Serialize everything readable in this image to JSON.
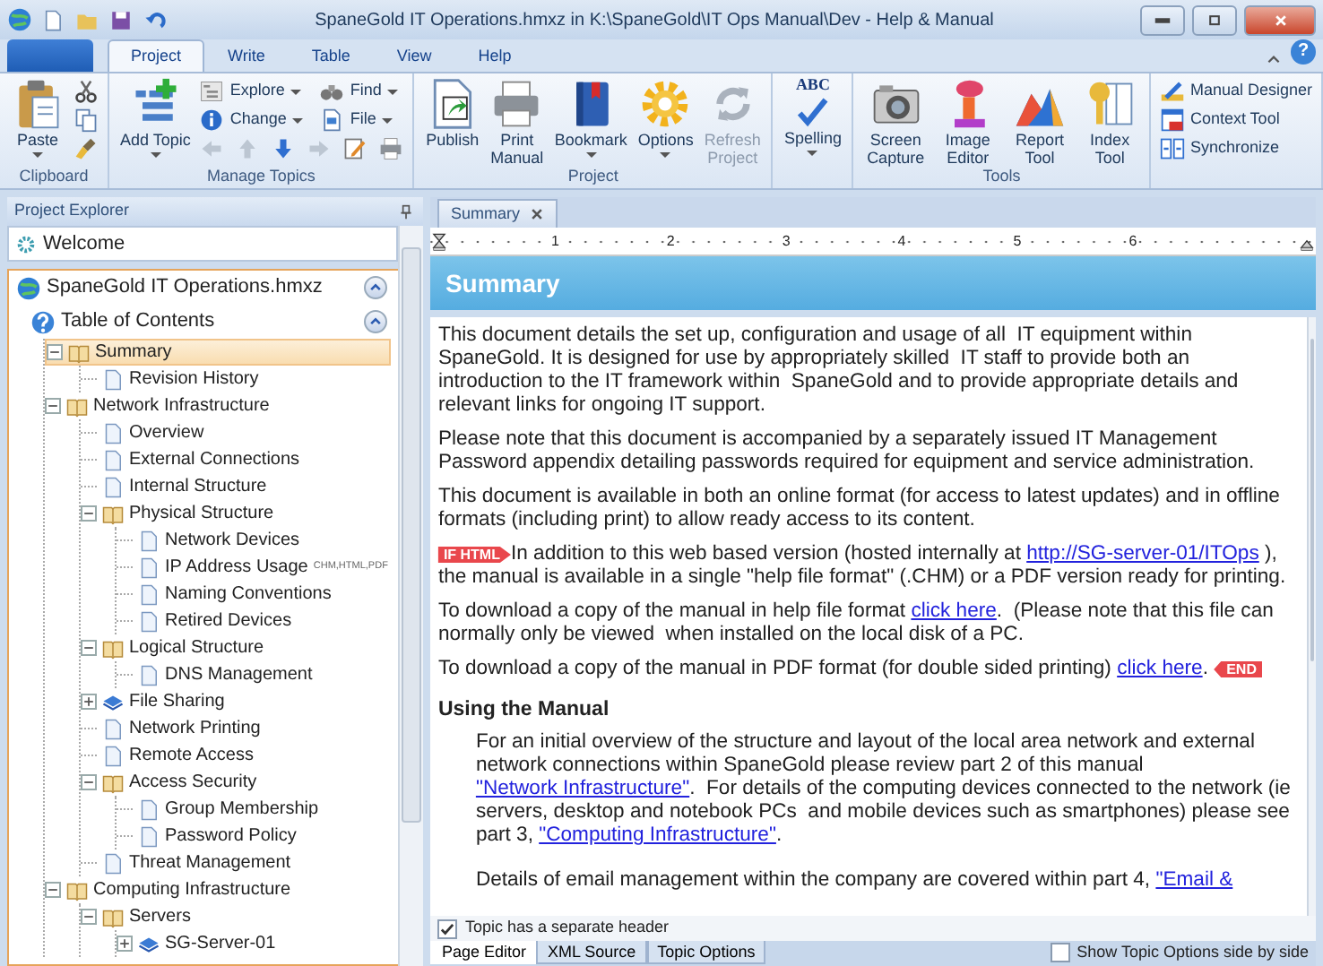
{
  "window": {
    "title": "SpaneGold IT Operations.hmxz in K:\\SpaneGold\\IT Ops Manual\\Dev - Help & Manual"
  },
  "ribbon_tabs": [
    {
      "label": "Project",
      "selected": true
    },
    {
      "label": "Write",
      "selected": false
    },
    {
      "label": "Table",
      "selected": false
    },
    {
      "label": "View",
      "selected": false
    },
    {
      "label": "Help",
      "selected": false
    }
  ],
  "help_button": "?",
  "ribbon_groups": [
    {
      "label": "Clipboard",
      "items": [
        {
          "label": "Paste",
          "kind": "large",
          "menu": true,
          "disabled": false
        }
      ]
    },
    {
      "label": "Manage Topics",
      "items": [
        {
          "label": "Add Topic",
          "kind": "wide",
          "menu": true,
          "disabled": false
        },
        {
          "label": "Explore",
          "kind": "small",
          "menu": true,
          "disabled": false
        },
        {
          "label": "Find",
          "kind": "small",
          "menu": true,
          "disabled": false
        },
        {
          "label": "Change",
          "kind": "small",
          "menu": true,
          "disabled": false
        },
        {
          "label": "File",
          "kind": "small",
          "menu": true,
          "disabled": false
        }
      ]
    },
    {
      "label": "Project",
      "items": [
        {
          "label": "Publish",
          "kind": "large",
          "menu": false,
          "disabled": false
        },
        {
          "label": "Print Manual",
          "kind": "large",
          "menu": false,
          "disabled": false
        },
        {
          "label": "Bookmark",
          "kind": "large",
          "menu": true,
          "disabled": false
        },
        {
          "label": "Options",
          "kind": "large",
          "menu": true,
          "disabled": false
        },
        {
          "label": "Refresh Project",
          "kind": "large",
          "menu": false,
          "disabled": true
        }
      ]
    },
    {
      "items": [
        {
          "label": "Spelling",
          "kind": "large",
          "menu": true,
          "disabled": false,
          "icon_text": "ABC"
        }
      ]
    },
    {
      "label": "Tools",
      "items": [
        {
          "label": "Screen Capture",
          "kind": "large",
          "menu": false,
          "disabled": false
        },
        {
          "label": "Image Editor",
          "kind": "large",
          "menu": false,
          "disabled": false
        },
        {
          "label": "Report Tool",
          "kind": "large",
          "menu": false,
          "disabled": false
        },
        {
          "label": "Index Tool",
          "kind": "large",
          "menu": false,
          "disabled": false
        }
      ]
    },
    {
      "items": [
        {
          "label": "Manual Designer",
          "kind": "list",
          "menu": false,
          "disabled": false
        },
        {
          "label": "Context Tool",
          "kind": "list",
          "menu": false,
          "disabled": false
        },
        {
          "label": "Synchronize",
          "kind": "list",
          "menu": false,
          "disabled": false
        }
      ]
    }
  ],
  "explorer": {
    "title": "Project Explorer",
    "welcome": "Welcome",
    "project": "SpaneGold IT Operations.hmxz",
    "toc": "Table of Contents",
    "tree": [
      {
        "label": "Summary",
        "kind": "book",
        "expanded": true,
        "selected": true,
        "children": [
          {
            "label": "Revision History",
            "kind": "page",
            "selected": false
          }
        ]
      },
      {
        "label": "Network Infrastructure",
        "kind": "book",
        "expanded": true,
        "selected": false,
        "children": [
          {
            "label": "Overview",
            "kind": "page",
            "selected": false
          },
          {
            "label": "External Connections",
            "kind": "page",
            "selected": false
          },
          {
            "label": "Internal Structure",
            "kind": "page",
            "selected": false
          },
          {
            "label": "Physical Structure",
            "kind": "book",
            "expanded": true,
            "selected": false,
            "children": [
              {
                "label": "Network Devices",
                "kind": "page",
                "selected": false
              },
              {
                "label": "IP Address Usage",
                "kind": "page",
                "selected": false,
                "tag": "CHM,HTML,PDF"
              },
              {
                "label": "Naming Conventions",
                "kind": "page",
                "selected": false
              },
              {
                "label": "Retired Devices",
                "kind": "page",
                "selected": false
              }
            ]
          },
          {
            "label": "Logical Structure",
            "kind": "book",
            "expanded": true,
            "selected": false,
            "children": [
              {
                "label": "DNS Management",
                "kind": "page",
                "selected": false
              }
            ]
          },
          {
            "label": "File Sharing",
            "kind": "folder",
            "expanded": false,
            "selected": false
          },
          {
            "label": "Network Printing",
            "kind": "page",
            "selected": false
          },
          {
            "label": "Remote Access",
            "kind": "page",
            "selected": false
          },
          {
            "label": "Access Security",
            "kind": "book",
            "expanded": true,
            "selected": false,
            "children": [
              {
                "label": "Group Membership",
                "kind": "page",
                "selected": false
              },
              {
                "label": "Password Policy",
                "kind": "page",
                "selected": false
              }
            ]
          },
          {
            "label": "Threat Management",
            "kind": "page",
            "selected": false
          }
        ]
      },
      {
        "label": "Computing Infrastructure",
        "kind": "book",
        "expanded": true,
        "selected": false,
        "children": [
          {
            "label": "Servers",
            "kind": "book",
            "expanded": true,
            "selected": false,
            "children": [
              {
                "label": "SG-Server-01",
                "kind": "folder",
                "expanded": false,
                "selected": false
              }
            ]
          }
        ]
      }
    ]
  },
  "editor": {
    "tab": "Summary",
    "ruler": [
      "1",
      "2",
      "3",
      "4",
      "5",
      "6"
    ],
    "header_title": "Summary",
    "blocks": [
      {
        "kind": "paragraph",
        "parts": [
          {
            "kind": "text",
            "text": "This document details the set up, configuration and usage of all  IT equipment within SpaneGold. It is designed for use by appropriately skilled  IT staff to provide both an introduction to the IT framework within  SpaneGold and to provide appropriate details and relevant links for ongoing IT support."
          }
        ]
      },
      {
        "kind": "paragraph",
        "parts": [
          {
            "kind": "text",
            "text": "Please note that this document is accompanied by a separately issued IT Management Password appendix detailing passwords required for equipment and service administration."
          }
        ]
      },
      {
        "kind": "paragraph",
        "parts": [
          {
            "kind": "text",
            "text": "This document is available in both an online format (for access to latest updates) and in offline formats (including print) to allow ready access to its content."
          }
        ]
      },
      {
        "kind": "paragraph",
        "parts": [
          {
            "kind": "condition_start",
            "text": "IF HTML"
          },
          {
            "kind": "text",
            "text": "In addition to this web based version (hosted internally at "
          },
          {
            "kind": "link",
            "text": "http://SG-server-01/ITOps"
          },
          {
            "kind": "text",
            "text": " ), the manual is available in a single \"help file format\" (.CHM) or a PDF version ready for printing."
          }
        ]
      },
      {
        "kind": "paragraph",
        "parts": [
          {
            "kind": "text",
            "text": "To download a copy of the manual in help file format "
          },
          {
            "kind": "link",
            "text": "click here"
          },
          {
            "kind": "text",
            "text": ".  (Please note that this file can normally only be viewed  when installed on the local disk of a PC."
          }
        ]
      },
      {
        "kind": "paragraph",
        "parts": [
          {
            "kind": "text",
            "text": "To download a copy of the manual in PDF format (for double sided printing) "
          },
          {
            "kind": "link",
            "text": "click here"
          },
          {
            "kind": "text",
            "text": ". "
          },
          {
            "kind": "condition_end",
            "text": "END"
          }
        ]
      },
      {
        "kind": "heading",
        "parts": [
          {
            "kind": "text",
            "text": "Using the Manual"
          }
        ]
      },
      {
        "kind": "indented",
        "parts": [
          {
            "kind": "text",
            "text": "For an initial overview of the structure and layout of the local area network and external network connections within SpaneGold please review part 2 of this manual "
          },
          {
            "kind": "link",
            "text": "\"Network Infrastructure\""
          },
          {
            "kind": "text",
            "text": ".  For details of the computing devices connected to the network (ie servers, desktop and notebook PCs  and mobile devices such as smartphones) please see part 3, "
          },
          {
            "kind": "link",
            "text": "\"Computing Infrastructure\""
          },
          {
            "kind": "text",
            "text": "."
          }
        ]
      },
      {
        "kind": "indented",
        "parts": [
          {
            "kind": "text",
            "text": "Details of email management within the company are covered within part 4, "
          },
          {
            "kind": "link",
            "text": "\"Email &"
          }
        ]
      }
    ],
    "separate_header": {
      "label": "Topic has a separate header",
      "checked": true
    },
    "bottom_tabs": [
      {
        "label": "Page Editor",
        "selected": true
      },
      {
        "label": "XML Source",
        "selected": false
      },
      {
        "label": "Topic Options",
        "selected": false
      }
    ],
    "side_by_side": {
      "label": "Show Topic Options side by side",
      "checked": false
    }
  }
}
